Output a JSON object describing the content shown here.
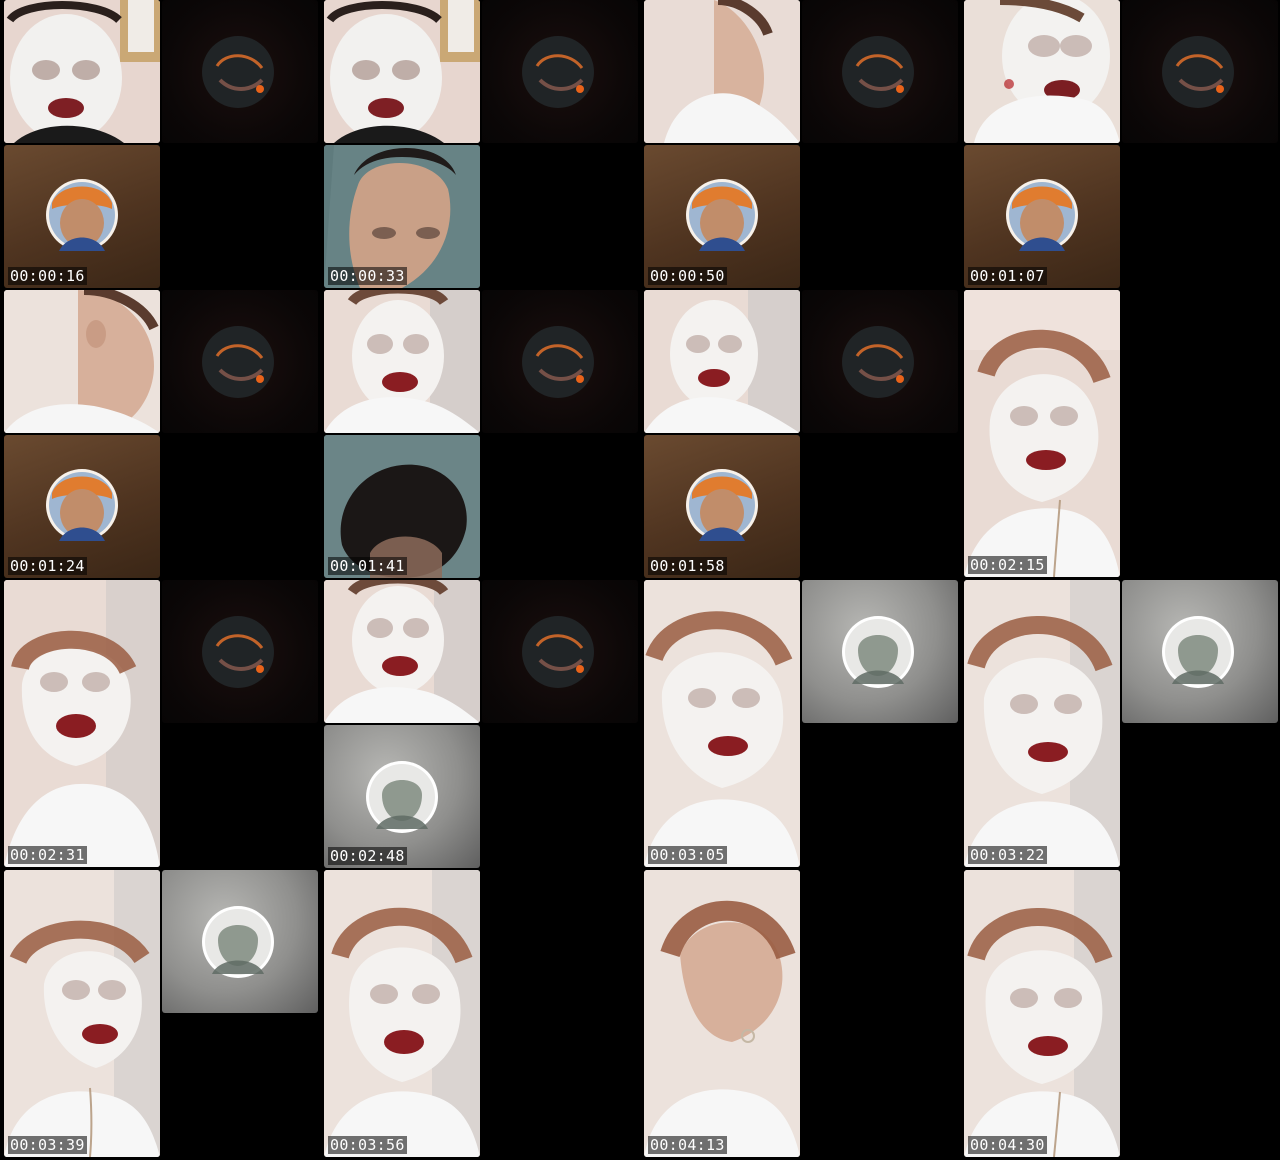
{
  "frames": [
    {
      "time": "00:00:16"
    },
    {
      "time": "00:00:33"
    },
    {
      "time": "00:00:50"
    },
    {
      "time": "00:01:07"
    },
    {
      "time": "00:01:24"
    },
    {
      "time": "00:01:41"
    },
    {
      "time": "00:01:58"
    },
    {
      "time": "00:02:15"
    },
    {
      "time": "00:02:31"
    },
    {
      "time": "00:02:48"
    },
    {
      "time": "00:03:05"
    },
    {
      "time": "00:03:22"
    },
    {
      "time": "00:03:39"
    },
    {
      "time": "00:03:56"
    },
    {
      "time": "00:04:13"
    },
    {
      "time": "00:04:30"
    }
  ]
}
